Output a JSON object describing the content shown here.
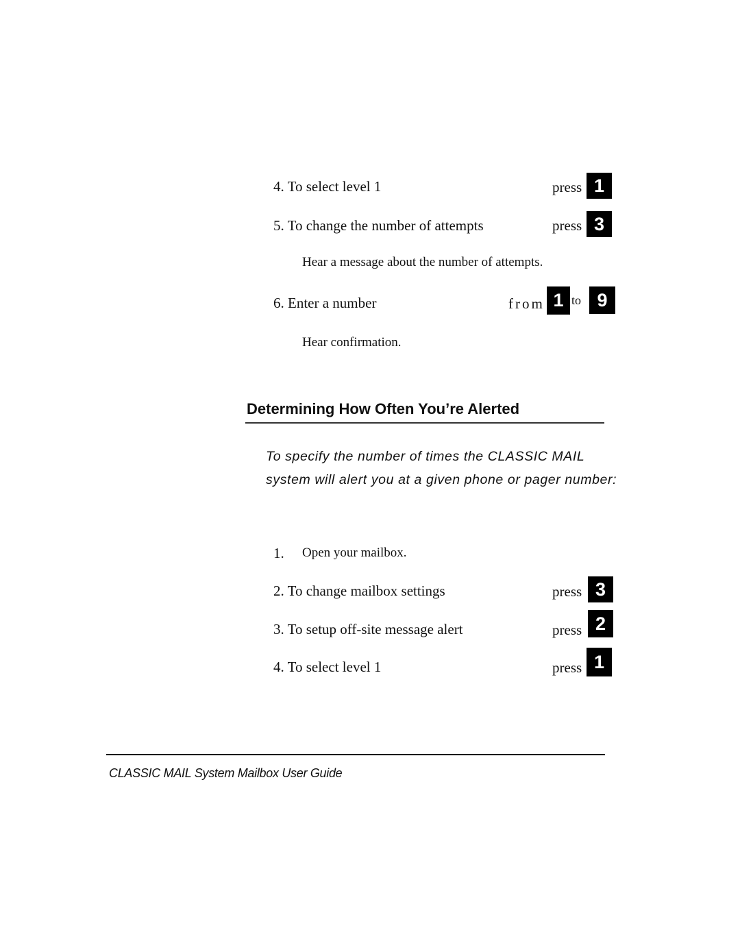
{
  "top_steps": [
    {
      "text": "4. To select level 1",
      "action": "press",
      "key": "1"
    },
    {
      "text": "5. To change the number of attempts",
      "action": "press",
      "key": "3"
    }
  ],
  "note_attempts": "Hear a message about the number of attempts.",
  "enter_number": {
    "text": "6. Enter a number",
    "from_label": "from",
    "from_key": "1",
    "to_label": "to",
    "to_key": "9"
  },
  "note_confirmation": "Hear confirmation.",
  "section": {
    "heading": "Determining How Often You’re Alerted",
    "intro": "To specify the number of times the CLASSIC MAIL system will alert you at a given phone or pager number:"
  },
  "open_step": {
    "number": "1.",
    "text": "Open your mailbox."
  },
  "bottom_steps": [
    {
      "text": "2. To change mailbox settings",
      "action": "press",
      "key": "3"
    },
    {
      "text": "3. To setup off-site message alert",
      "action": "press",
      "key": "2"
    },
    {
      "text": "4. To select level 1",
      "action": "press",
      "key": "1"
    }
  ],
  "footer": "CLASSIC MAIL System Mailbox User Guide"
}
